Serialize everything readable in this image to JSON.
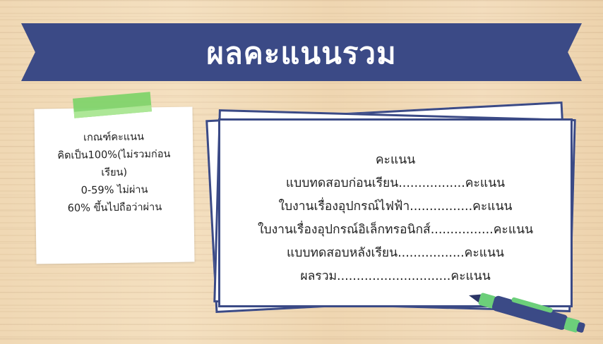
{
  "banner": {
    "title": "ผลคะแนนรวม"
  },
  "criteria_note": {
    "lines": [
      "เกณฑ์คะแนน",
      "คิดเป็น100%(ไม่รวมก่อน",
      "เรียน)",
      "0-59% ไม่ผ่าน",
      "60% ขึ้นไปถือว่าผ่าน"
    ]
  },
  "score_sheet": {
    "heading": "คะแนน",
    "lines": [
      "แบบทดสอบก่อนเรียน.................คะแนน",
      "ใบงานเรื่องอุปกรณ์ไฟฟ้า................คะแนน",
      "ใบงานเรื่องอุปกรณ์อิเล็กทรอนิกส์................คะแนน",
      "แบบทดสอบหลังเรียน.................คะแนน",
      "ผลรวม.............................คะแนน"
    ]
  },
  "colors": {
    "banner": "#3b4a86",
    "tape": "#7ed46a",
    "paper_border": "#3b4a86",
    "pen_body": "#3b4a86",
    "pen_accent": "#6ccf7a"
  },
  "icons": {
    "tape": "green-tape-strip",
    "pen": "pen-icon"
  }
}
